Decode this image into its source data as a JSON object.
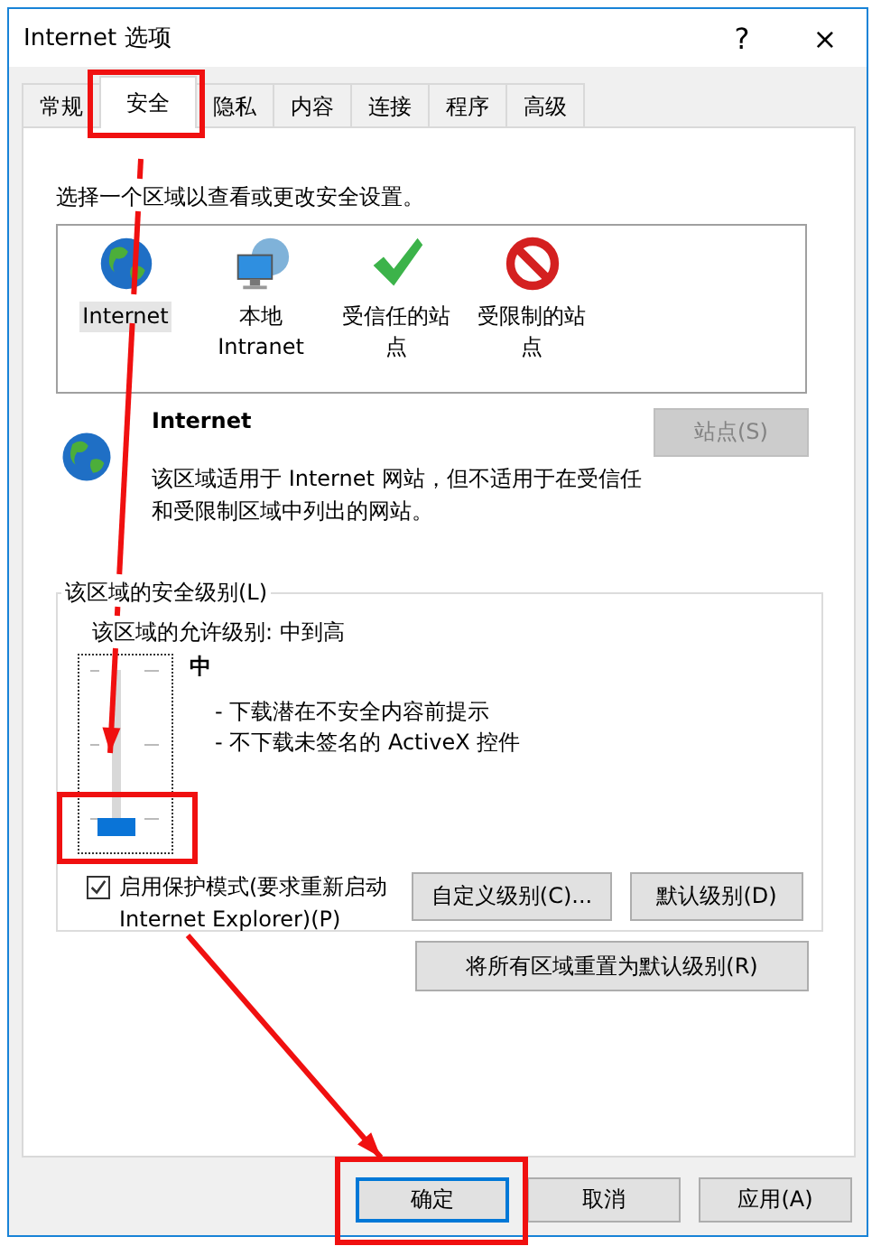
{
  "window": {
    "title": "Internet 选项",
    "help": "?",
    "close": "×"
  },
  "tabs": [
    {
      "label": "常规",
      "selected": false
    },
    {
      "label": "安全",
      "selected": true
    },
    {
      "label": "隐私",
      "selected": false
    },
    {
      "label": "内容",
      "selected": false
    },
    {
      "label": "连接",
      "selected": false
    },
    {
      "label": "程序",
      "selected": false
    },
    {
      "label": "高级",
      "selected": false
    }
  ],
  "zone_prompt": "选择一个区域以查看或更改安全设置。",
  "zones": [
    {
      "label": "Internet",
      "kind": "globe",
      "selected": true
    },
    {
      "label": "本地 Intranet",
      "kind": "intranet",
      "selected": false
    },
    {
      "label": "受信任的站点",
      "kind": "trusted",
      "selected": false
    },
    {
      "label": "受限制的站点",
      "kind": "restricted",
      "selected": false
    }
  ],
  "zone_detail": {
    "title": "Internet",
    "description": "该区域适用于 Internet 网站，但不适用于在受信任和受限制区域中列出的网站。",
    "sites_button": {
      "label": "站点(S)",
      "disabled": true
    }
  },
  "security_level": {
    "legend": "该区域的安全级别(L)",
    "allowed": "该区域的允许级别: 中到高",
    "slider": {
      "level": 0
    },
    "level_name": "中",
    "notes": [
      "- 下载潜在不安全内容前提示",
      "- 不下载未签名的 ActiveX 控件"
    ],
    "protected_mode": {
      "label": "启用保护模式(要求重新启动 Internet Explorer)(P)",
      "checked": true
    },
    "buttons": [
      "自定义级别(C)...",
      "默认级别(D)"
    ],
    "reset_button": "将所有区域重置为默认级别(R)"
  },
  "dialog_buttons": [
    {
      "label": "确定",
      "focused": true
    },
    {
      "label": "取消",
      "focused": false
    },
    {
      "label": "应用(A)",
      "focused": false
    }
  ],
  "annotations": [
    {
      "kind": "box"
    },
    {
      "kind": "arrow"
    },
    {
      "kind": "box"
    },
    {
      "kind": "arrow"
    },
    {
      "kind": "box"
    }
  ]
}
